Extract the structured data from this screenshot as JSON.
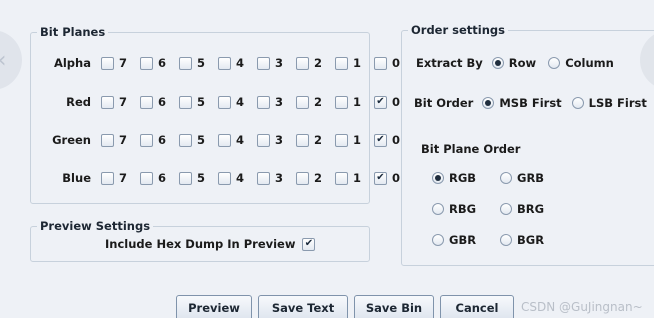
{
  "bit_planes": {
    "title": "Bit Planes",
    "bit_labels": [
      "7",
      "6",
      "5",
      "4",
      "3",
      "2",
      "1",
      "0"
    ],
    "rows": [
      {
        "label": "Alpha",
        "checked": [
          false,
          false,
          false,
          false,
          false,
          false,
          false,
          false
        ]
      },
      {
        "label": "Red",
        "checked": [
          false,
          false,
          false,
          false,
          false,
          false,
          false,
          true
        ]
      },
      {
        "label": "Green",
        "checked": [
          false,
          false,
          false,
          false,
          false,
          false,
          false,
          true
        ]
      },
      {
        "label": "Blue",
        "checked": [
          false,
          false,
          false,
          false,
          false,
          false,
          false,
          true
        ]
      }
    ]
  },
  "preview_settings": {
    "title": "Preview Settings",
    "hex_dump_label": "Include Hex Dump In Preview",
    "hex_dump_checked": true
  },
  "order_settings": {
    "title": "Order settings",
    "extract_by_label": "Extract By",
    "extract_by_options": [
      {
        "label": "Row",
        "selected": true
      },
      {
        "label": "Column",
        "selected": false
      }
    ],
    "bit_order_label": "Bit Order",
    "bit_order_options": [
      {
        "label": "MSB First",
        "selected": true
      },
      {
        "label": "LSB First",
        "selected": false
      }
    ],
    "bit_plane_order_label": "Bit Plane Order",
    "plane_order_options": [
      {
        "label": "RGB",
        "selected": true
      },
      {
        "label": "GRB",
        "selected": false
      },
      {
        "label": "RBG",
        "selected": false
      },
      {
        "label": "BRG",
        "selected": false
      },
      {
        "label": "GBR",
        "selected": false
      },
      {
        "label": "BGR",
        "selected": false
      }
    ]
  },
  "buttons": {
    "preview": "Preview",
    "save_text": "Save Text",
    "save_bin": "Save Bin",
    "cancel": "Cancel"
  },
  "watermark": "CSDN @GuJingnan~",
  "check_glyph": "✔"
}
